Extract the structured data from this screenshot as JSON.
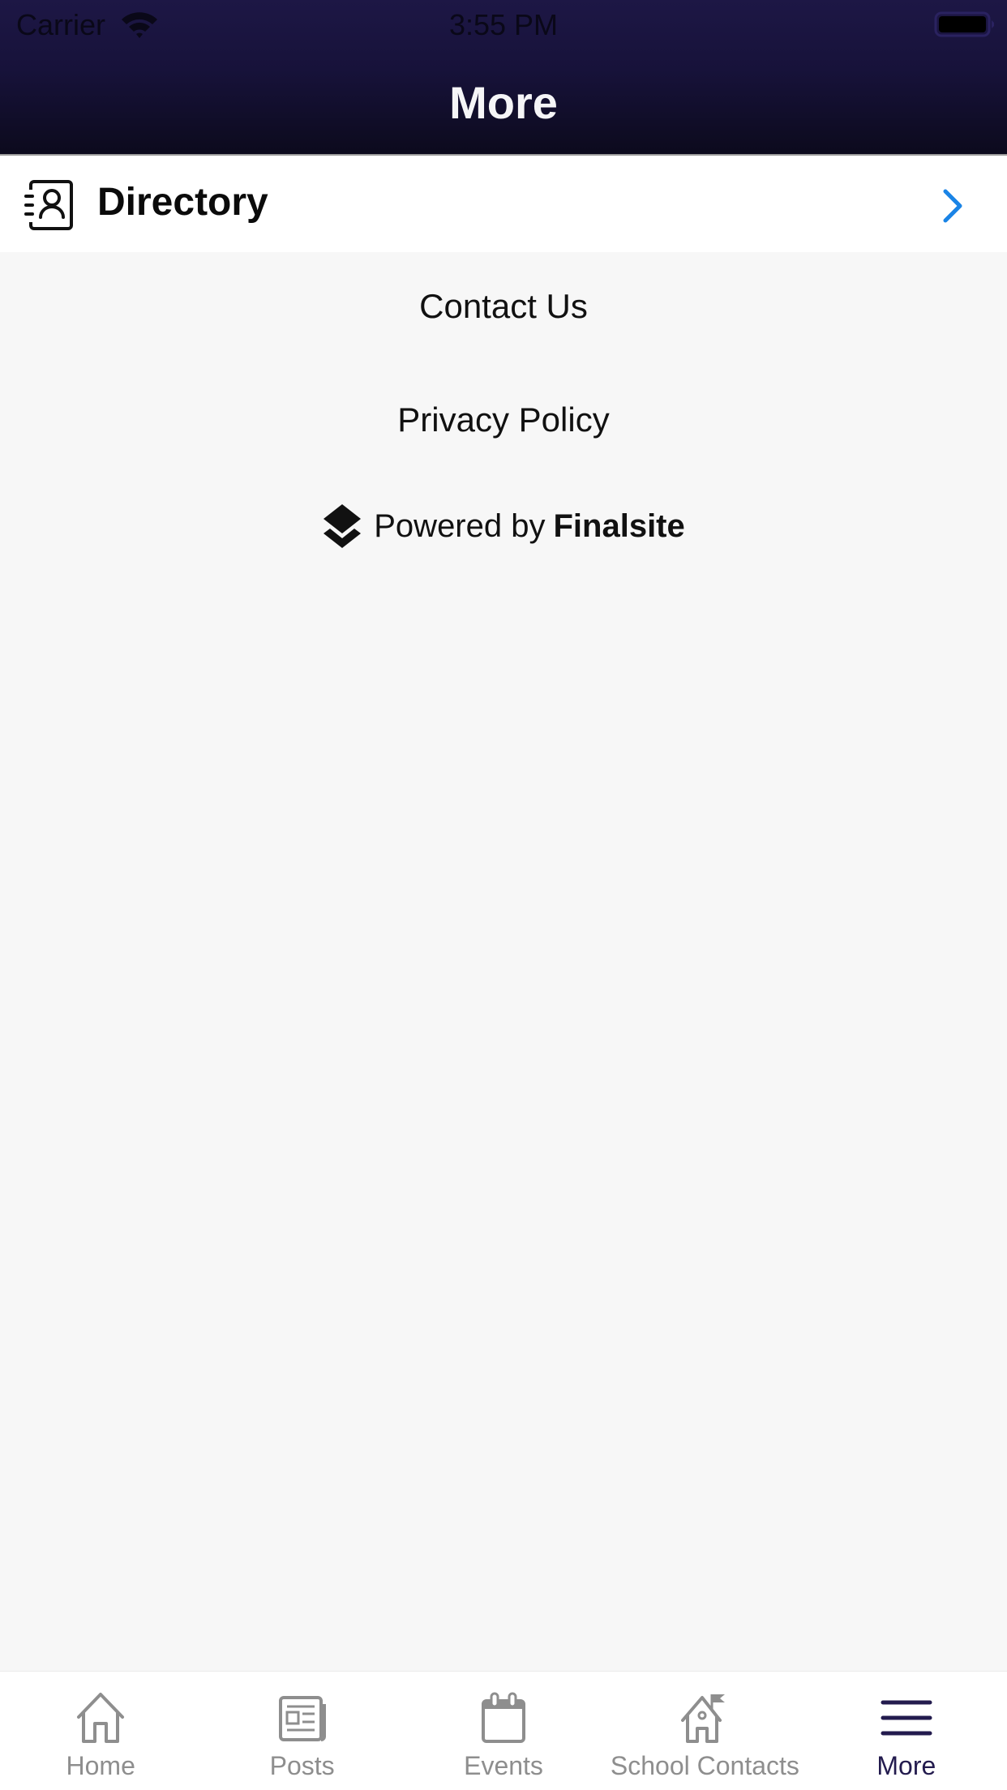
{
  "status_bar": {
    "carrier": "Carrier",
    "time": "3:55 PM",
    "wifi_icon": "wifi-icon",
    "battery_icon": "battery-icon"
  },
  "header": {
    "title": "More",
    "colors": {
      "top": "#1d1745",
      "bottom": "#0c0a1d"
    }
  },
  "menu": {
    "directory": {
      "label": "Directory",
      "icon": "contact-book-icon",
      "chevron_icon": "chevron-right-icon",
      "chevron_color": "#1a84e6"
    }
  },
  "links": {
    "contact_us": "Contact Us",
    "privacy_policy": "Privacy Policy"
  },
  "footer": {
    "powered_by": "Powered by",
    "brand": "Finalsite",
    "icon": "layers-icon"
  },
  "tabbar": {
    "active_color": "#231b4e",
    "inactive_color": "#8e8e8e",
    "tabs": [
      {
        "label": "Home",
        "icon": "home-icon",
        "active": false
      },
      {
        "label": "Posts",
        "icon": "newspaper-icon",
        "active": false
      },
      {
        "label": "Events",
        "icon": "calendar-icon",
        "active": false
      },
      {
        "label": "School Contacts",
        "icon": "school-icon",
        "active": false
      },
      {
        "label": "More",
        "icon": "menu-icon",
        "active": true
      }
    ]
  }
}
